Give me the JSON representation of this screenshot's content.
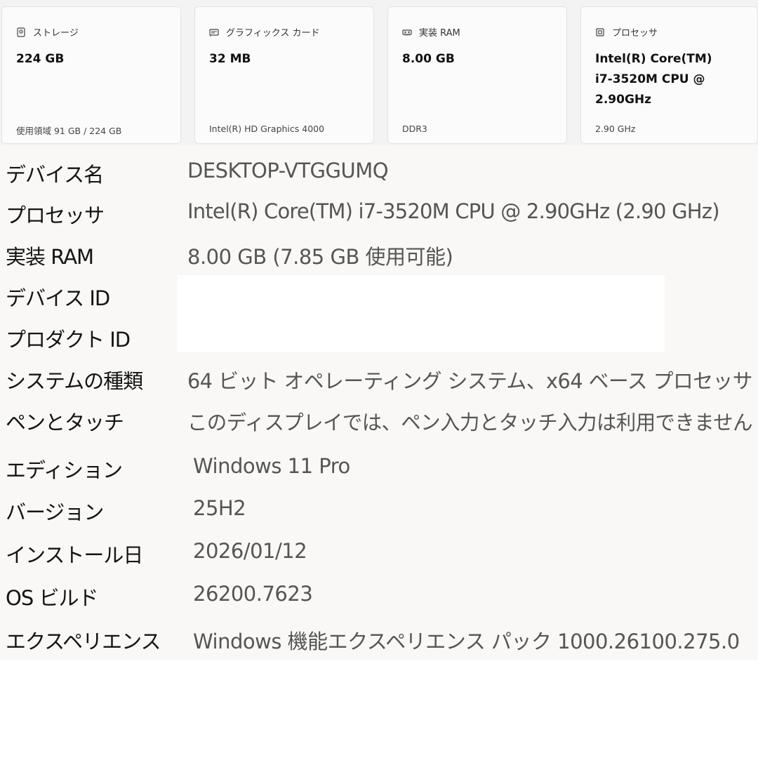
{
  "cards": [
    {
      "icon": "storage-icon",
      "title": "ストレージ",
      "value": "224 GB",
      "sub": "使用領域 91 GB / 224 GB"
    },
    {
      "icon": "graphics-card-icon",
      "title": "グラフィックス カード",
      "value": "32 MB",
      "sub": "Intel(R) HD Graphics 4000"
    },
    {
      "icon": "ram-icon",
      "title": "実装 RAM",
      "value": "8.00 GB",
      "sub": "DDR3"
    },
    {
      "icon": "processor-icon",
      "title": "プロセッサ",
      "value": "Intel(R) Core(TM) i7-3520M CPU @ 2.90GHz",
      "sub": "2.90 GHz"
    }
  ],
  "specs": [
    {
      "label": "デバイス名",
      "value": "DESKTOP-VTGGUMQ"
    },
    {
      "label": "プロセッサ",
      "value": "Intel(R) Core(TM) i7-3520M CPU @ 2.90GHz (2.90 GHz)"
    },
    {
      "label": "実装 RAM",
      "value": "8.00 GB (7.85 GB 使用可能)"
    },
    {
      "label": "デバイス ID",
      "value": ""
    },
    {
      "label": "プロダクト ID",
      "value": ""
    },
    {
      "label": "システムの種類",
      "value": "64 ビット オペレーティング システム、x64 ベース プロセッサ"
    },
    {
      "label": "ペンとタッチ",
      "value": "このディスプレイでは、ペン入力とタッチ入力は利用できません"
    },
    {
      "label": "エディション",
      "value": "Windows 11 Pro"
    },
    {
      "label": "バージョン",
      "value": "25H2"
    },
    {
      "label": "インストール日",
      "value": "2026/01/12"
    },
    {
      "label": "OS ビルド",
      "value": "26200.7623"
    },
    {
      "label": "エクスペリエンス",
      "value": "Windows 機能エクスペリエンス パック 1000.26100.275.0"
    }
  ]
}
